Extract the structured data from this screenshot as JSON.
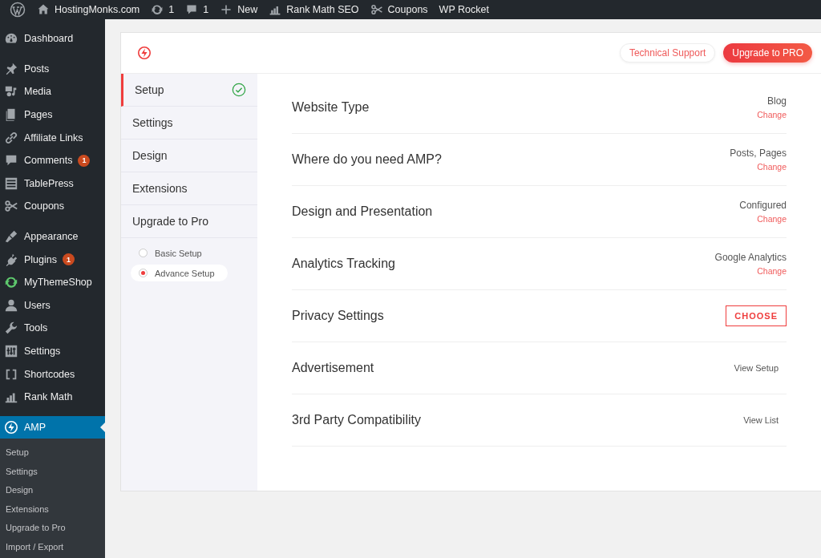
{
  "admin_bar": {
    "items": [
      {
        "kind": "wp-logo"
      },
      {
        "kind": "site",
        "label": "HostingMonks.com"
      },
      {
        "kind": "updates",
        "label": "1"
      },
      {
        "kind": "comments",
        "label": "1"
      },
      {
        "kind": "new",
        "label": "New"
      },
      {
        "kind": "rank-math",
        "label": "Rank Math SEO"
      },
      {
        "kind": "coupons",
        "label": "Coupons"
      },
      {
        "kind": "text",
        "label": "WP Rocket"
      }
    ]
  },
  "sidebar": {
    "groups": [
      [
        {
          "label": "Dashboard",
          "kind": "dashboard",
          "selected": false
        }
      ],
      [
        {
          "label": "Posts",
          "kind": "pin",
          "selected": false
        },
        {
          "label": "Media",
          "kind": "media",
          "selected": false
        },
        {
          "label": "Pages",
          "kind": "pages",
          "selected": false
        },
        {
          "label": "Affiliate Links",
          "kind": "link",
          "selected": false
        },
        {
          "label": "Comments",
          "kind": "comment",
          "badge": "1",
          "selected": false
        },
        {
          "label": "TablePress",
          "kind": "table",
          "selected": false
        },
        {
          "label": "Coupons",
          "kind": "scissors",
          "selected": false
        }
      ],
      [
        {
          "label": "Appearance",
          "kind": "brush",
          "selected": false
        },
        {
          "label": "Plugins",
          "kind": "plug",
          "badge": "1",
          "selected": false
        },
        {
          "label": "MyThemeShop",
          "kind": "sync",
          "selected": false
        },
        {
          "label": "Users",
          "kind": "user",
          "selected": false
        },
        {
          "label": "Tools",
          "kind": "wrench",
          "selected": false
        },
        {
          "label": "Settings",
          "kind": "sliders",
          "selected": false
        },
        {
          "label": "Shortcodes",
          "kind": "brackets",
          "selected": false
        },
        {
          "label": "Rank Math",
          "kind": "chart",
          "selected": false
        }
      ],
      [
        {
          "label": "AMP",
          "kind": "bolt",
          "selected": true,
          "submenu": [
            {
              "label": "Setup",
              "selected": false
            },
            {
              "label": "Settings",
              "selected": false
            },
            {
              "label": "Design",
              "selected": false
            },
            {
              "label": "Extensions",
              "selected": false
            },
            {
              "label": "Upgrade to Pro",
              "selected": false
            },
            {
              "label": "Import / Export",
              "selected": false
            }
          ]
        }
      ]
    ]
  },
  "panel": {
    "header_buttons": [
      {
        "label": "Technical Support",
        "kind": "outline"
      },
      {
        "label": "Upgrade to PRO",
        "kind": "primary"
      }
    ],
    "nav": [
      {
        "label": "Setup",
        "selected": true,
        "done": true
      },
      {
        "label": "Settings",
        "selected": false,
        "done": false
      },
      {
        "label": "Design",
        "selected": false,
        "done": false
      },
      {
        "label": "Extensions",
        "selected": false,
        "done": false
      },
      {
        "label": "Upgrade to Pro",
        "selected": false,
        "done": false
      }
    ],
    "setup_modes": [
      {
        "label": "Basic Setup",
        "selected": false
      },
      {
        "label": "Advance Setup",
        "selected": true
      }
    ],
    "rows": [
      {
        "title": "Website Type",
        "kind": "value",
        "value": "Blog",
        "action": "Change"
      },
      {
        "title": "Where do you need AMP?",
        "kind": "value",
        "value": "Posts, Pages",
        "action": "Change"
      },
      {
        "title": "Design and Presentation",
        "kind": "value",
        "value": "Configured",
        "action": "Change"
      },
      {
        "title": "Analytics Tracking",
        "kind": "value",
        "value": "Google Analytics",
        "action": "Change"
      },
      {
        "title": "Privacy Settings",
        "kind": "button",
        "action": "CHOOSE"
      },
      {
        "title": "Advertisement",
        "kind": "link",
        "action": "View Setup"
      },
      {
        "title": "3rd Party Compatibility",
        "kind": "link",
        "action": "View List"
      }
    ]
  }
}
